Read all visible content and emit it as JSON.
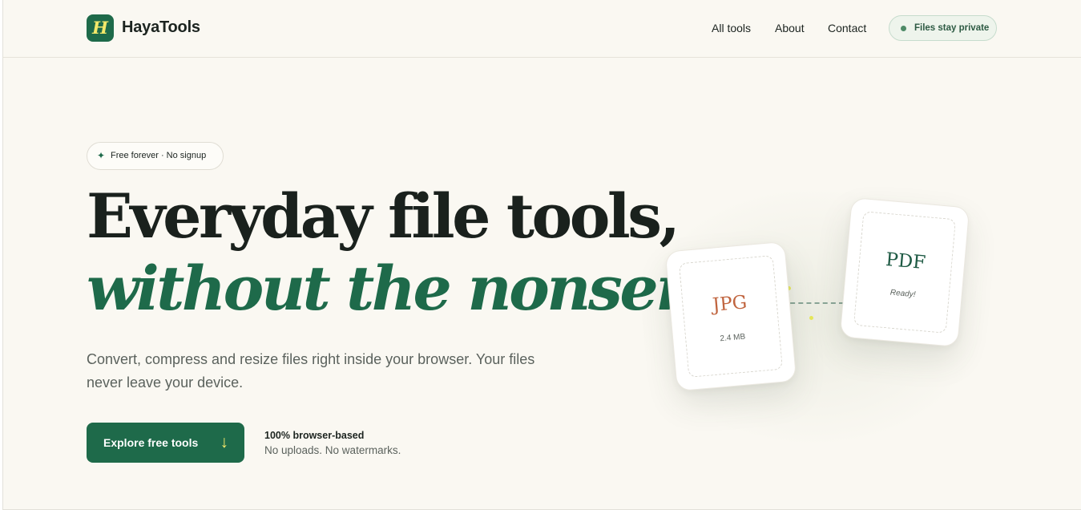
{
  "brand": {
    "logo_letter": "H",
    "name": "HayaTools"
  },
  "nav": {
    "items": [
      "All tools",
      "About",
      "Contact"
    ],
    "privacy_pill": "Files stay private"
  },
  "hero": {
    "badge": "Free forever · No signup",
    "headline_line1": "Everyday file tools,",
    "headline_line2": "without the nonsense.",
    "subtitle": "Convert, compress and resize files right inside your browser. Your files never leave your device.",
    "cta_label": "Explore free tools",
    "cta_arrow": "↓",
    "note_title": "100% browser-based",
    "note_sub": "No uploads. No watermarks."
  },
  "illustration": {
    "source_card": {
      "format": "JPG",
      "meta": "2.4 MB"
    },
    "target_card": {
      "format": "PDF",
      "meta": "Ready!"
    }
  },
  "icons": {
    "badge": "sparkle-icon",
    "cta": "arrow-down-icon",
    "pill": "status-dot-icon"
  },
  "colors": {
    "brand_green": "#1e6a4a",
    "accent_yellow": "#f4e86a",
    "jpg_orange": "#c0643e",
    "background": "#faf8f2"
  }
}
